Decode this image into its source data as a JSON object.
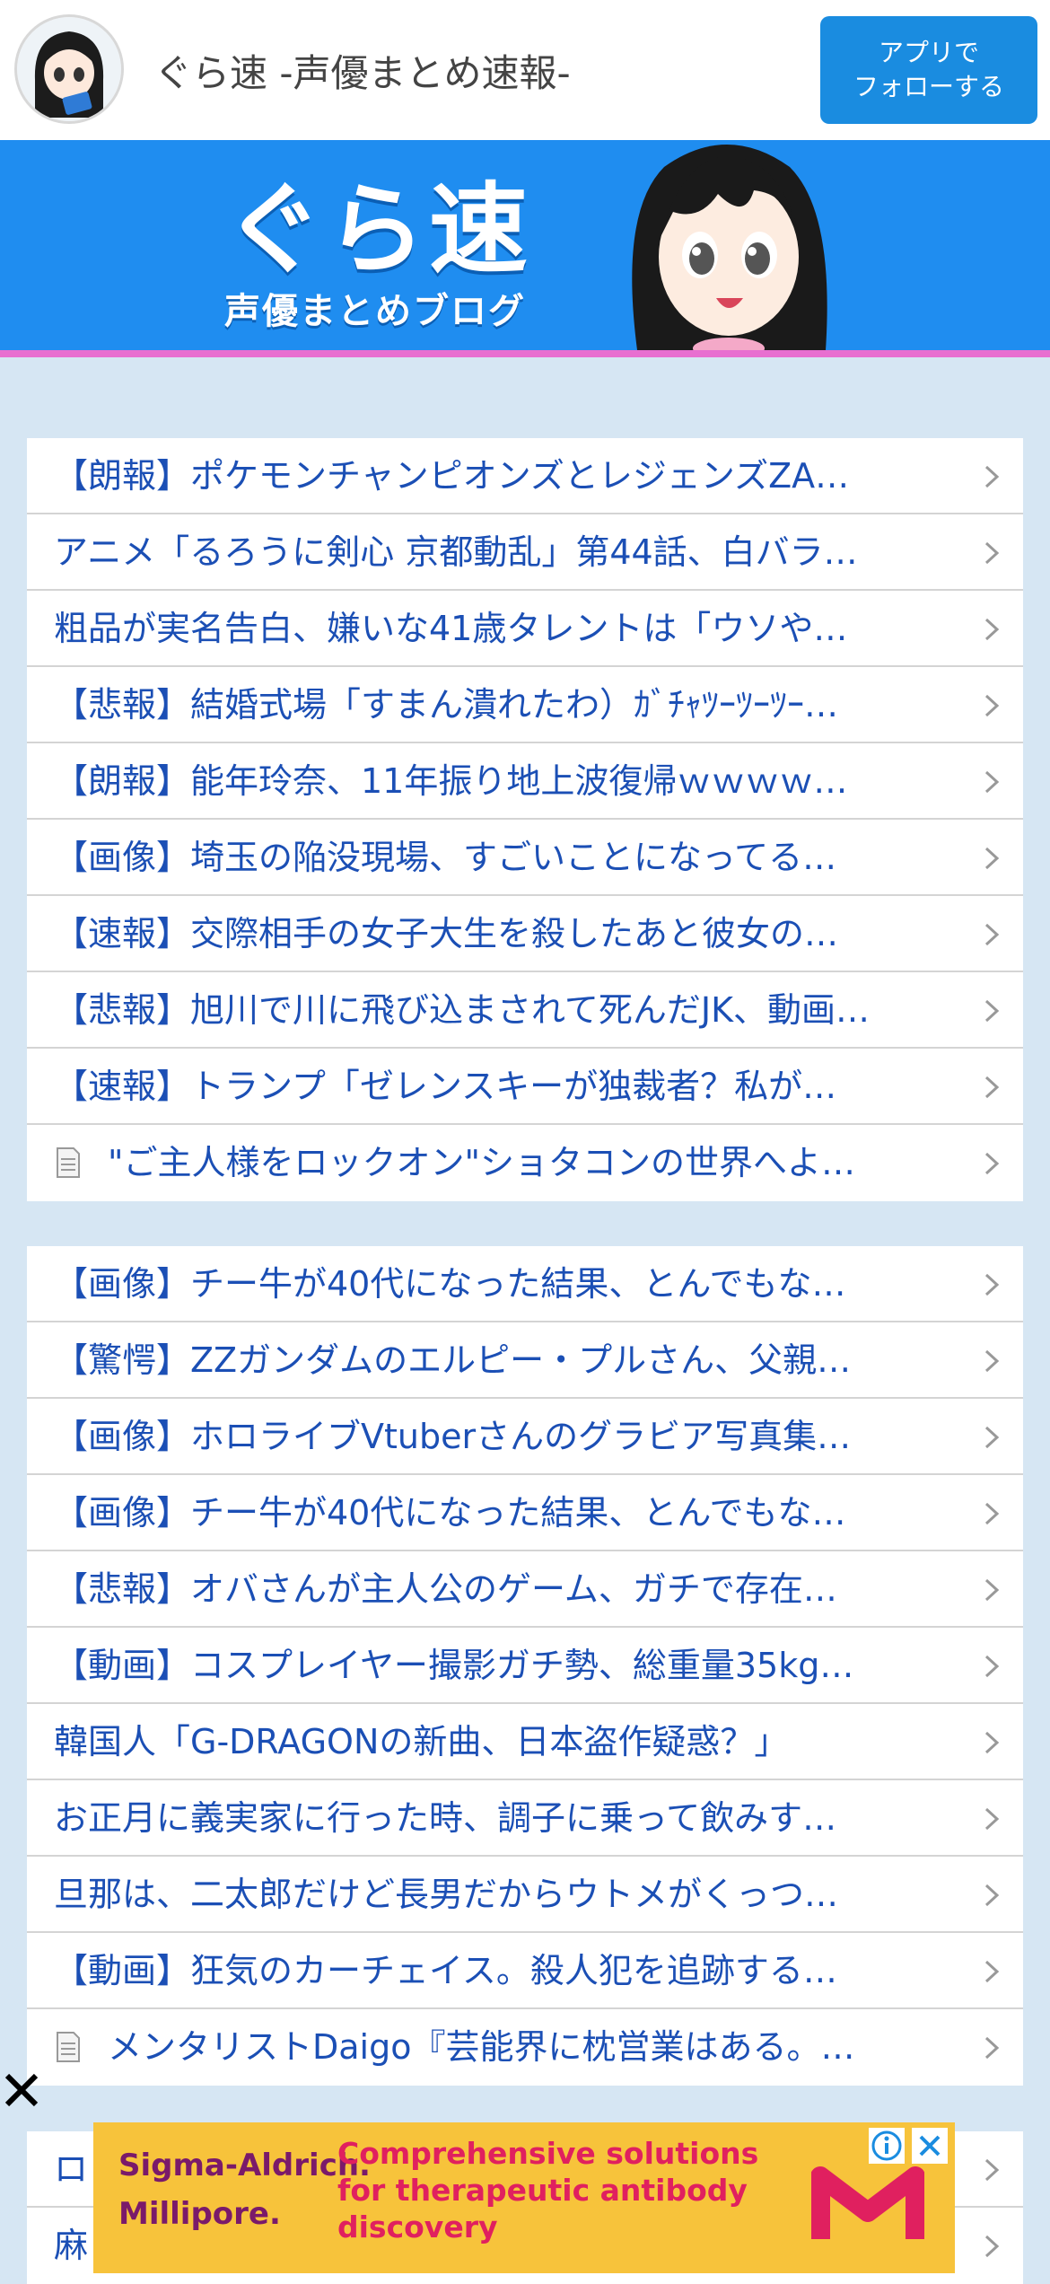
{
  "header": {
    "site_title": "ぐら速 -声優まとめ速報-",
    "follow_button_line1": "アプリで",
    "follow_button_line2": "フォローする"
  },
  "banner": {
    "logo_text": "ぐら速",
    "subtitle": "声優まとめブログ"
  },
  "list1": [
    {
      "text": "【朗報】ポケモンチャンピオンズとレジェンズZA…",
      "doc": false
    },
    {
      "text": "アニメ「るろうに剣心 京都動乱」第44話、白バラ…",
      "doc": false
    },
    {
      "text": "粗品が実名告白、嫌いな41歳タレントは「ウソや…",
      "doc": false
    },
    {
      "text": "【悲報】結婚式場「すまん潰れたわ）ｶﾞﾁｬﾂｰﾂｰﾂｰ…",
      "doc": false
    },
    {
      "text": "【朗報】能年玲奈、11年振り地上波復帰ｗｗｗｗ…",
      "doc": false
    },
    {
      "text": "【画像】埼玉の陥没現場、すごいことになってる…",
      "doc": false
    },
    {
      "text": "【速報】交際相手の女子大生を殺したあと彼女の…",
      "doc": false
    },
    {
      "text": "【悲報】旭川で川に飛び込まされて死んだJK、動画…",
      "doc": false
    },
    {
      "text": "【速報】トランプ「ゼレンスキーが独裁者？私が…",
      "doc": false
    },
    {
      "text": "\"ご主人様をロックオン\"ショタコンの世界へよ…",
      "doc": true
    }
  ],
  "list2": [
    {
      "text": "【画像】チー牛が40代になった結果、とんでもな…",
      "doc": false
    },
    {
      "text": "【驚愕】ZZガンダムのエルピー・プルさん、父親…",
      "doc": false
    },
    {
      "text": "【画像】ホロライブVtuberさんのグラビア写真集…",
      "doc": false
    },
    {
      "text": "【画像】チー牛が40代になった結果、とんでもな…",
      "doc": false
    },
    {
      "text": "【悲報】オバさんが主人公のゲーム、ガチで存在…",
      "doc": false
    },
    {
      "text": "【動画】コスプレイヤー撮影ガチ勢、総重量35kg…",
      "doc": false
    },
    {
      "text": "韓国人「G-DRAGONの新曲、日本盗作疑惑？」",
      "doc": false
    },
    {
      "text": "お正月に義実家に行った時、調子に乗って飲みす…",
      "doc": false
    },
    {
      "text": "旦那は、二太郎だけど長男だからウトメがくっつ…",
      "doc": false
    },
    {
      "text": "【動画】狂気のカーチェイス。殺人犯を追跡する…",
      "doc": false
    },
    {
      "text": "メンタリストDaigo『芸能界に枕営業はある。…",
      "doc": true
    }
  ],
  "list3": [
    {
      "text": "ロ",
      "doc": false
    },
    {
      "text": "麻",
      "doc": false
    }
  ],
  "ad": {
    "brand_line1": "Sigma-Aldrich.",
    "brand_line2": "Millipore.",
    "copy": "Comprehensive solutions for therapeutic antibody discovery"
  },
  "colors": {
    "link": "#1b4fb5",
    "banner": "#1f8df0",
    "accent_line": "#e86fd0",
    "follow_button": "#1a8ce0",
    "page_bg": "#d6e6f3",
    "ad_bg": "#f7c33b"
  }
}
